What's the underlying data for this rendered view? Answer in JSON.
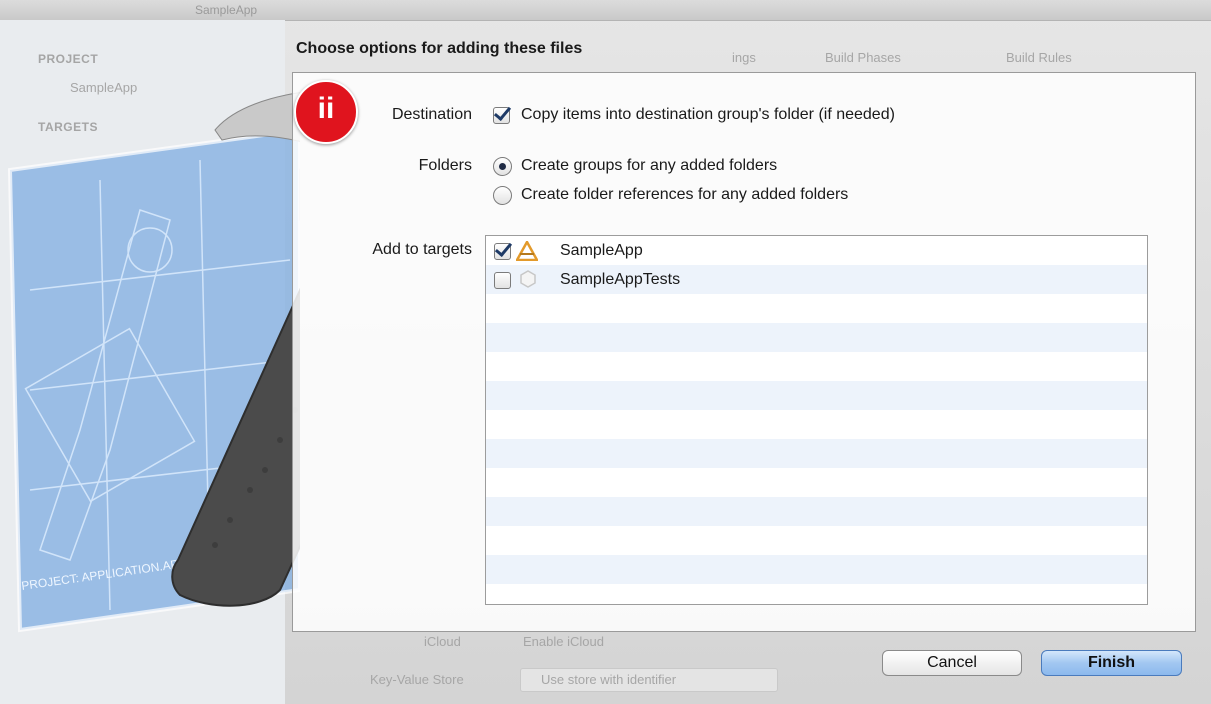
{
  "background": {
    "window_title": "SampleApp",
    "project_header": "PROJECT",
    "project_item": "SampleApp",
    "targets_header": "TARGETS",
    "tab_capabilities_partial": "ings",
    "tab_build_phases": "Build Phases",
    "tab_build_rules": "Build Rules",
    "icloud_label": "iCloud",
    "icloud_value": "Enable iCloud",
    "kvs_label": "Key-Value Store",
    "kvs_value": "Use store with identifier",
    "art_project_text": "PROJECT: APPLICATION.APP"
  },
  "sheet": {
    "title": "Choose options for adding these files",
    "badge": "ii",
    "destination": {
      "label": "Destination",
      "checkbox_label": "Copy items into destination group's folder (if needed)",
      "checked": true
    },
    "folders": {
      "label": "Folders",
      "options": [
        {
          "label": "Create groups for any added folders",
          "selected": true
        },
        {
          "label": "Create folder references for any added folders",
          "selected": false
        }
      ]
    },
    "targets": {
      "label": "Add to targets",
      "items": [
        {
          "name": "SampleApp",
          "checked": true,
          "icon": "app-target-icon"
        },
        {
          "name": "SampleAppTests",
          "checked": false,
          "icon": "test-bundle-icon"
        }
      ]
    },
    "buttons": {
      "cancel": "Cancel",
      "finish": "Finish"
    }
  },
  "colors": {
    "badge": "#e0141e",
    "finish_button": "#a2c7f1",
    "blueprint": "#6e9fd8"
  }
}
